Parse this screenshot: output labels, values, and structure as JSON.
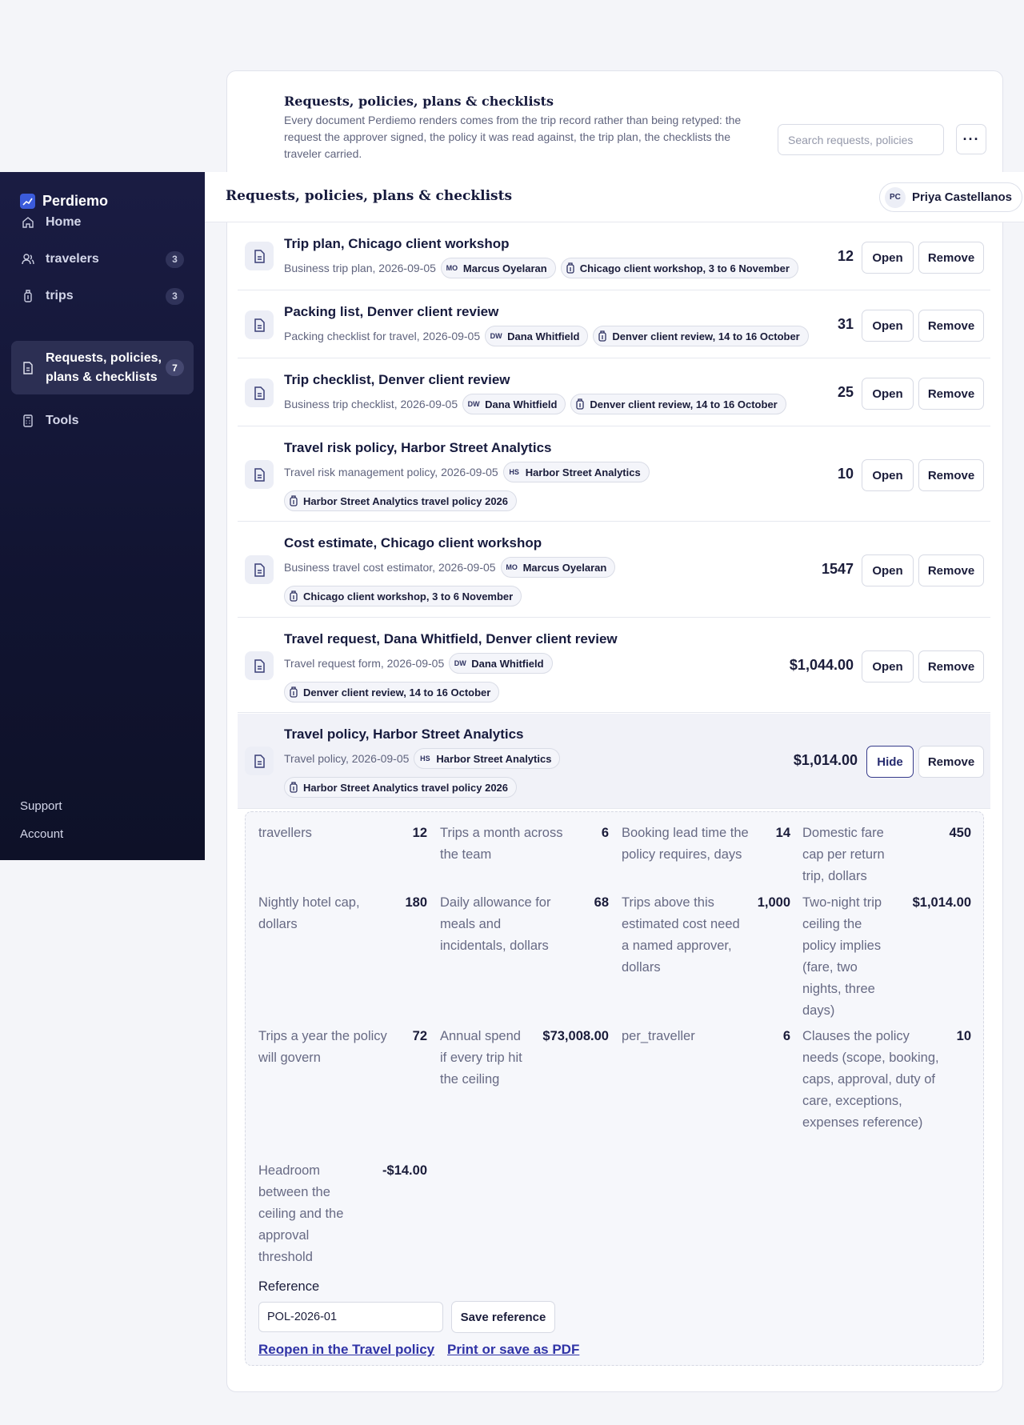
{
  "card": {
    "title": "Requests, policies, plans & checklists",
    "description": "Every document Perdiemo renders comes from the trip record rather than being retyped: the request the approver signed, the policy it was read against, the trip plan, the checklists the traveler carried.",
    "search_placeholder": "Search requests, policies",
    "more_label": "···"
  },
  "topbar": {
    "title": "Requests, policies, plans & checklists",
    "user_initials": "PC",
    "user_name": "Priya Castellanos"
  },
  "sidebar": {
    "brand": "Perdiemo",
    "items": [
      {
        "label": "Home",
        "badge": ""
      },
      {
        "label": "travelers",
        "badge": "3"
      },
      {
        "label": "trips",
        "badge": "3"
      },
      {
        "label": "Requests, policies, plans & checklists",
        "badge": "7"
      },
      {
        "label": "Tools",
        "badge": ""
      }
    ],
    "support": "Support",
    "account": "Account"
  },
  "rows": [
    {
      "title": "Trip plan, Chicago client workshop",
      "type": "Business trip plan, 2026-09-05",
      "person_initials": "MO",
      "person": "Marcus Oyelaran",
      "attachment": "Chicago client workshop, 3 to 6 November",
      "value": "12",
      "open": "Open",
      "remove": "Remove"
    },
    {
      "title": "Packing list, Denver client review",
      "type": "Packing checklist for travel, 2026-09-05",
      "person_initials": "DW",
      "person": "Dana Whitfield",
      "attachment": "Denver client review, 14 to 16 October",
      "value": "31",
      "open": "Open",
      "remove": "Remove"
    },
    {
      "title": "Trip checklist, Denver client review",
      "type": "Business trip checklist, 2026-09-05",
      "person_initials": "DW",
      "person": "Dana Whitfield",
      "attachment": "Denver client review, 14 to 16 October",
      "value": "25",
      "open": "Open",
      "remove": "Remove"
    },
    {
      "title": "Travel risk policy, Harbor Street Analytics",
      "type": "Travel risk management policy, 2026-09-05",
      "person_initials": "HS",
      "person": "Harbor Street Analytics",
      "attachment": "Harbor Street Analytics travel policy 2026",
      "value": "10",
      "open": "Open",
      "remove": "Remove"
    },
    {
      "title": "Cost estimate, Chicago client workshop",
      "type": "Business travel cost estimator, 2026-09-05",
      "person_initials": "MO",
      "person": "Marcus Oyelaran",
      "attachment": "Chicago client workshop, 3 to 6 November",
      "value": "1547",
      "open": "Open",
      "remove": "Remove"
    },
    {
      "title": "Travel request, Dana Whitfield, Denver client review",
      "type": "Travel request form, 2026-09-05",
      "person_initials": "DW",
      "person": "Dana Whitfield",
      "attachment": "Denver client review, 14 to 16 October",
      "value": "$1,044.00",
      "open": "Open",
      "remove": "Remove"
    },
    {
      "title": "Travel policy, Harbor Street Analytics",
      "type": "Travel policy, 2026-09-05",
      "person_initials": "HS",
      "person": "Harbor Street Analytics",
      "attachment": "Harbor Street Analytics travel policy 2026",
      "value": "$1,014.00",
      "open": "Hide",
      "remove": "Remove"
    }
  ],
  "detail": {
    "metrics": [
      {
        "label": "travellers",
        "value": "12"
      },
      {
        "label": "Trips a month across the team",
        "value": "6"
      },
      {
        "label": "Booking lead time the policy requires, days",
        "value": "14"
      },
      {
        "label": "Domestic fare cap per return trip, dollars",
        "value": "450"
      },
      {
        "label": "Nightly hotel cap, dollars",
        "value": "180"
      },
      {
        "label": "Daily allowance for meals and incidentals, dollars",
        "value": "68"
      },
      {
        "label": "Trips above this estimated cost need a named approver, dollars",
        "value": "1,000"
      },
      {
        "label": "Two-night trip ceiling the policy implies (fare, two nights, three days)",
        "value": "$1,014.00"
      },
      {
        "label": "Trips a year the policy will govern",
        "value": "72"
      },
      {
        "label": "Annual spend if every trip hit the ceiling",
        "value": "$73,008.00"
      },
      {
        "label": "per_traveller",
        "value": "6"
      },
      {
        "label": "Clauses the policy needs (scope, booking, caps, approval, duty of care, exceptions, expenses reference)",
        "value": "10"
      },
      {
        "label": "Headroom between the ceiling and the approval threshold",
        "value": "-$14.00"
      }
    ],
    "reference_label": "Reference",
    "reference_value": "POL-2026-01",
    "save_label": "Save reference",
    "reopen_link": "Reopen in the Travel policy",
    "print_link": "Print or save as PDF"
  },
  "colors": {
    "accent": "#2f33a6",
    "sidebar": "#141737",
    "brand": "#3b5bdb"
  }
}
